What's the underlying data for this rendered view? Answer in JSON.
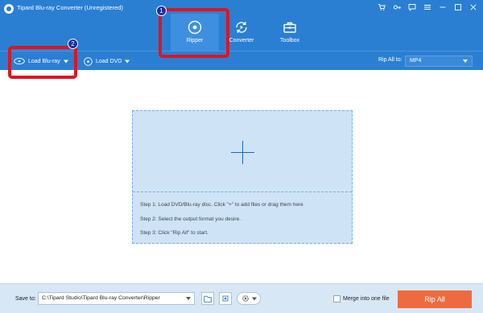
{
  "window": {
    "title": "Tipard Blu-ray Converter (Unregistered)",
    "controls": [
      "cart-icon",
      "key-icon",
      "chat-icon",
      "menu-icon",
      "minimize-icon",
      "maximize-icon",
      "close-icon"
    ]
  },
  "tabs": [
    {
      "label": "Ripper",
      "icon": "disc-icon",
      "active": true
    },
    {
      "label": "Converter",
      "icon": "convert-icon",
      "active": false
    },
    {
      "label": "Toolbox",
      "icon": "toolbox-icon",
      "active": false
    }
  ],
  "toolbar": {
    "load_bluray": "Load Blu-ray",
    "load_dvd": "Load DVD",
    "rip_all_to_label": "Rip All to:",
    "format_value": "MP4"
  },
  "annotations": [
    {
      "label": "1"
    },
    {
      "label": "2"
    }
  ],
  "dropzone": {
    "step1": "Step 1: Load DVD/Blu-ray disc. Click \"+\" to add files or drag them here",
    "step2": "Step 2: Select the output format you desire.",
    "step3": "Step 3: Click \"Rip All\" to start."
  },
  "bottom": {
    "save_to_label": "Save to:",
    "save_path": "C:\\Tipard Studio\\Tipard Blu-ray Converter\\Ripper",
    "merge_label": "Merge into one file",
    "merge_checked": false,
    "rip_all_button": "Rip All"
  },
  "colors": {
    "header_blue": "#2a7fd3",
    "active_tab": "#3f8fe0",
    "highlight_red": "#e0141f",
    "badge_navy": "#1d2d9e",
    "dropzone_fill": "#cfe3f6",
    "bottom_bar": "#d7e7f6",
    "rip_all_orange": "#ef6b3f"
  }
}
